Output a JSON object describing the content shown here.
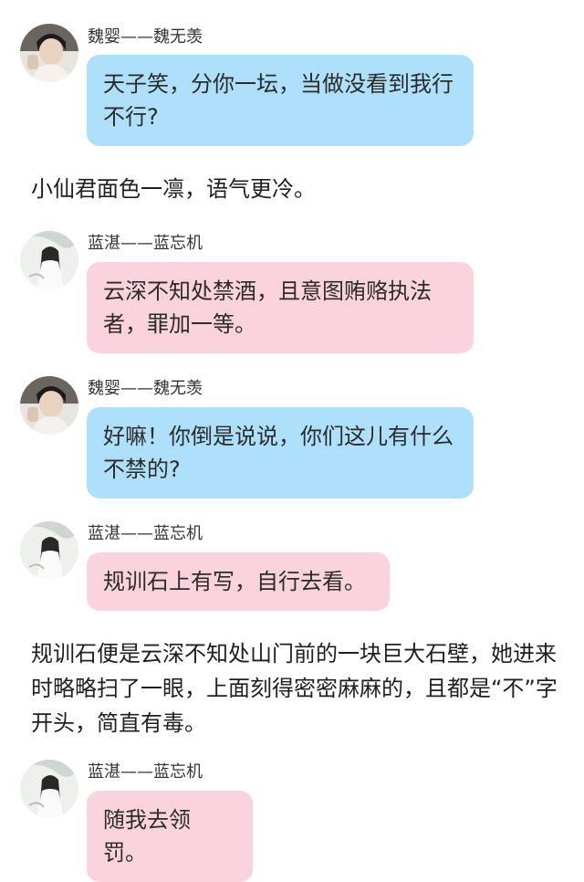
{
  "messages": [
    {
      "speaker": "魏婴——魏无羡",
      "text": "天子笑，分你一坛，当做没看到我行不行?",
      "avatar": "weiying-avatar"
    },
    {
      "speaker": "蓝湛——蓝忘机",
      "text": "云深不知处禁酒，且意图贿赂执法者，罪加一等。",
      "avatar": "lanzhan-avatar"
    },
    {
      "speaker": "魏婴——魏无羡",
      "text": "好嘛！你倒是说说，你们这儿有什么不禁的?",
      "avatar": "weiying-avatar"
    },
    {
      "speaker": "蓝湛——蓝忘机",
      "text": "规训石上有写，自行去看。",
      "avatar": "lanzhan-avatar"
    },
    {
      "speaker": "蓝湛——蓝忘机",
      "text": "随我去领罚。",
      "avatar": "lanzhan-avatar"
    }
  ],
  "narration": [
    "小仙君面色一凛，语气更冷。",
    "规训石便是云深不知处山门前的一块巨大石壁，她进来时略略扫了一眼，上面刻得密密麻麻的，且都是“不”字开头，简直有毒。"
  ],
  "colors": {
    "blue_bubble": "#aee0fc",
    "pink_bubble": "#fbd3de"
  }
}
